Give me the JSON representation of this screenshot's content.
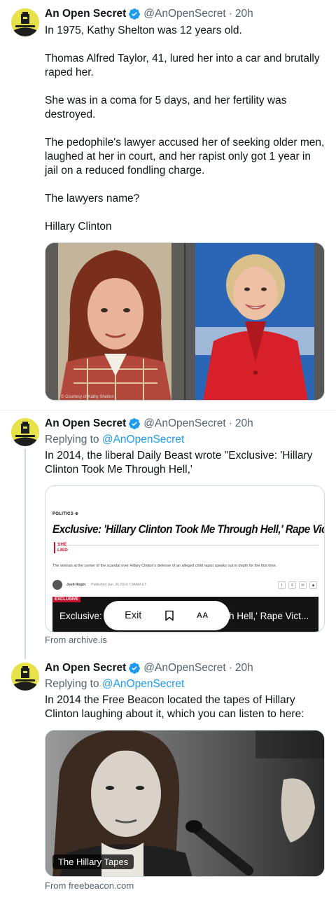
{
  "tweets": [
    {
      "display_name": "An Open Secret",
      "handle": "@AnOpenSecret",
      "time": "20h",
      "paragraphs": [
        "In 1975, Kathy Shelton was 12 years old.",
        "Thomas Alfred Taylor, 41, lured her into a car and brutally raped her.",
        "She was in a coma for 5 days, and her fertility was destroyed.",
        "The pedophile's lawyer accused her of seeking older men, laughed at her in court, and her rapist only got 1 year in jail on a reduced fondling charge.",
        "The lawyers name?",
        "Hillary Clinton"
      ],
      "image_credit": "© Courtesy of Kathy Shelton"
    },
    {
      "display_name": "An Open Secret",
      "handle": "@AnOpenSecret",
      "time": "20h",
      "replying_prefix": "Replying to",
      "replying_to": "@AnOpenSecret",
      "text": "In 2014, the liberal Daily Beast wrote \"Exclusive: 'Hillary Clinton Took Me Through Hell,'",
      "card": {
        "kicker": "POLITICS",
        "headline": "Exclusive: 'Hillary Clinton Took Me Through Hell,' Rape Victim Says",
        "tag_lines": [
          "SHE",
          "LIED"
        ],
        "dek": "The woman at the center of the scandal over Hillary Clinton's defense of an alleged child rapist speaks out in depth for the first time.",
        "byline": "Josh Rogin",
        "byline_date": "Published Jun. 20 2014 7:34AM ET",
        "exclusive_tag": "EXCLUSIVE",
        "video_title_left": "Exclusive: '",
        "video_title_right": "h Hell,' Rape Vict...",
        "share_icons": [
          "f",
          "X",
          "✉",
          "◆"
        ]
      },
      "reader_pill": {
        "exit_label": "Exit",
        "aa_label": "AA"
      },
      "source": "From archive.is"
    },
    {
      "display_name": "An Open Secret",
      "handle": "@AnOpenSecret",
      "time": "20h",
      "replying_prefix": "Replying to",
      "replying_to": "@AnOpenSecret",
      "text": "In 2014 the Free Beacon located the tapes of Hillary Clinton laughing about it, which you can listen to here:",
      "card_label": "The Hillary Tapes",
      "source": "From freebeacon.com"
    }
  ],
  "colors": {
    "accent": "#1d9bf0",
    "text_primary": "#0f1419",
    "text_secondary": "#536471",
    "avatar_bg": "#e8e24a",
    "red_jacket": "#d8202a"
  },
  "icons": [
    "verified-badge-icon",
    "bookmark-icon",
    "archive-logo-icon"
  ]
}
